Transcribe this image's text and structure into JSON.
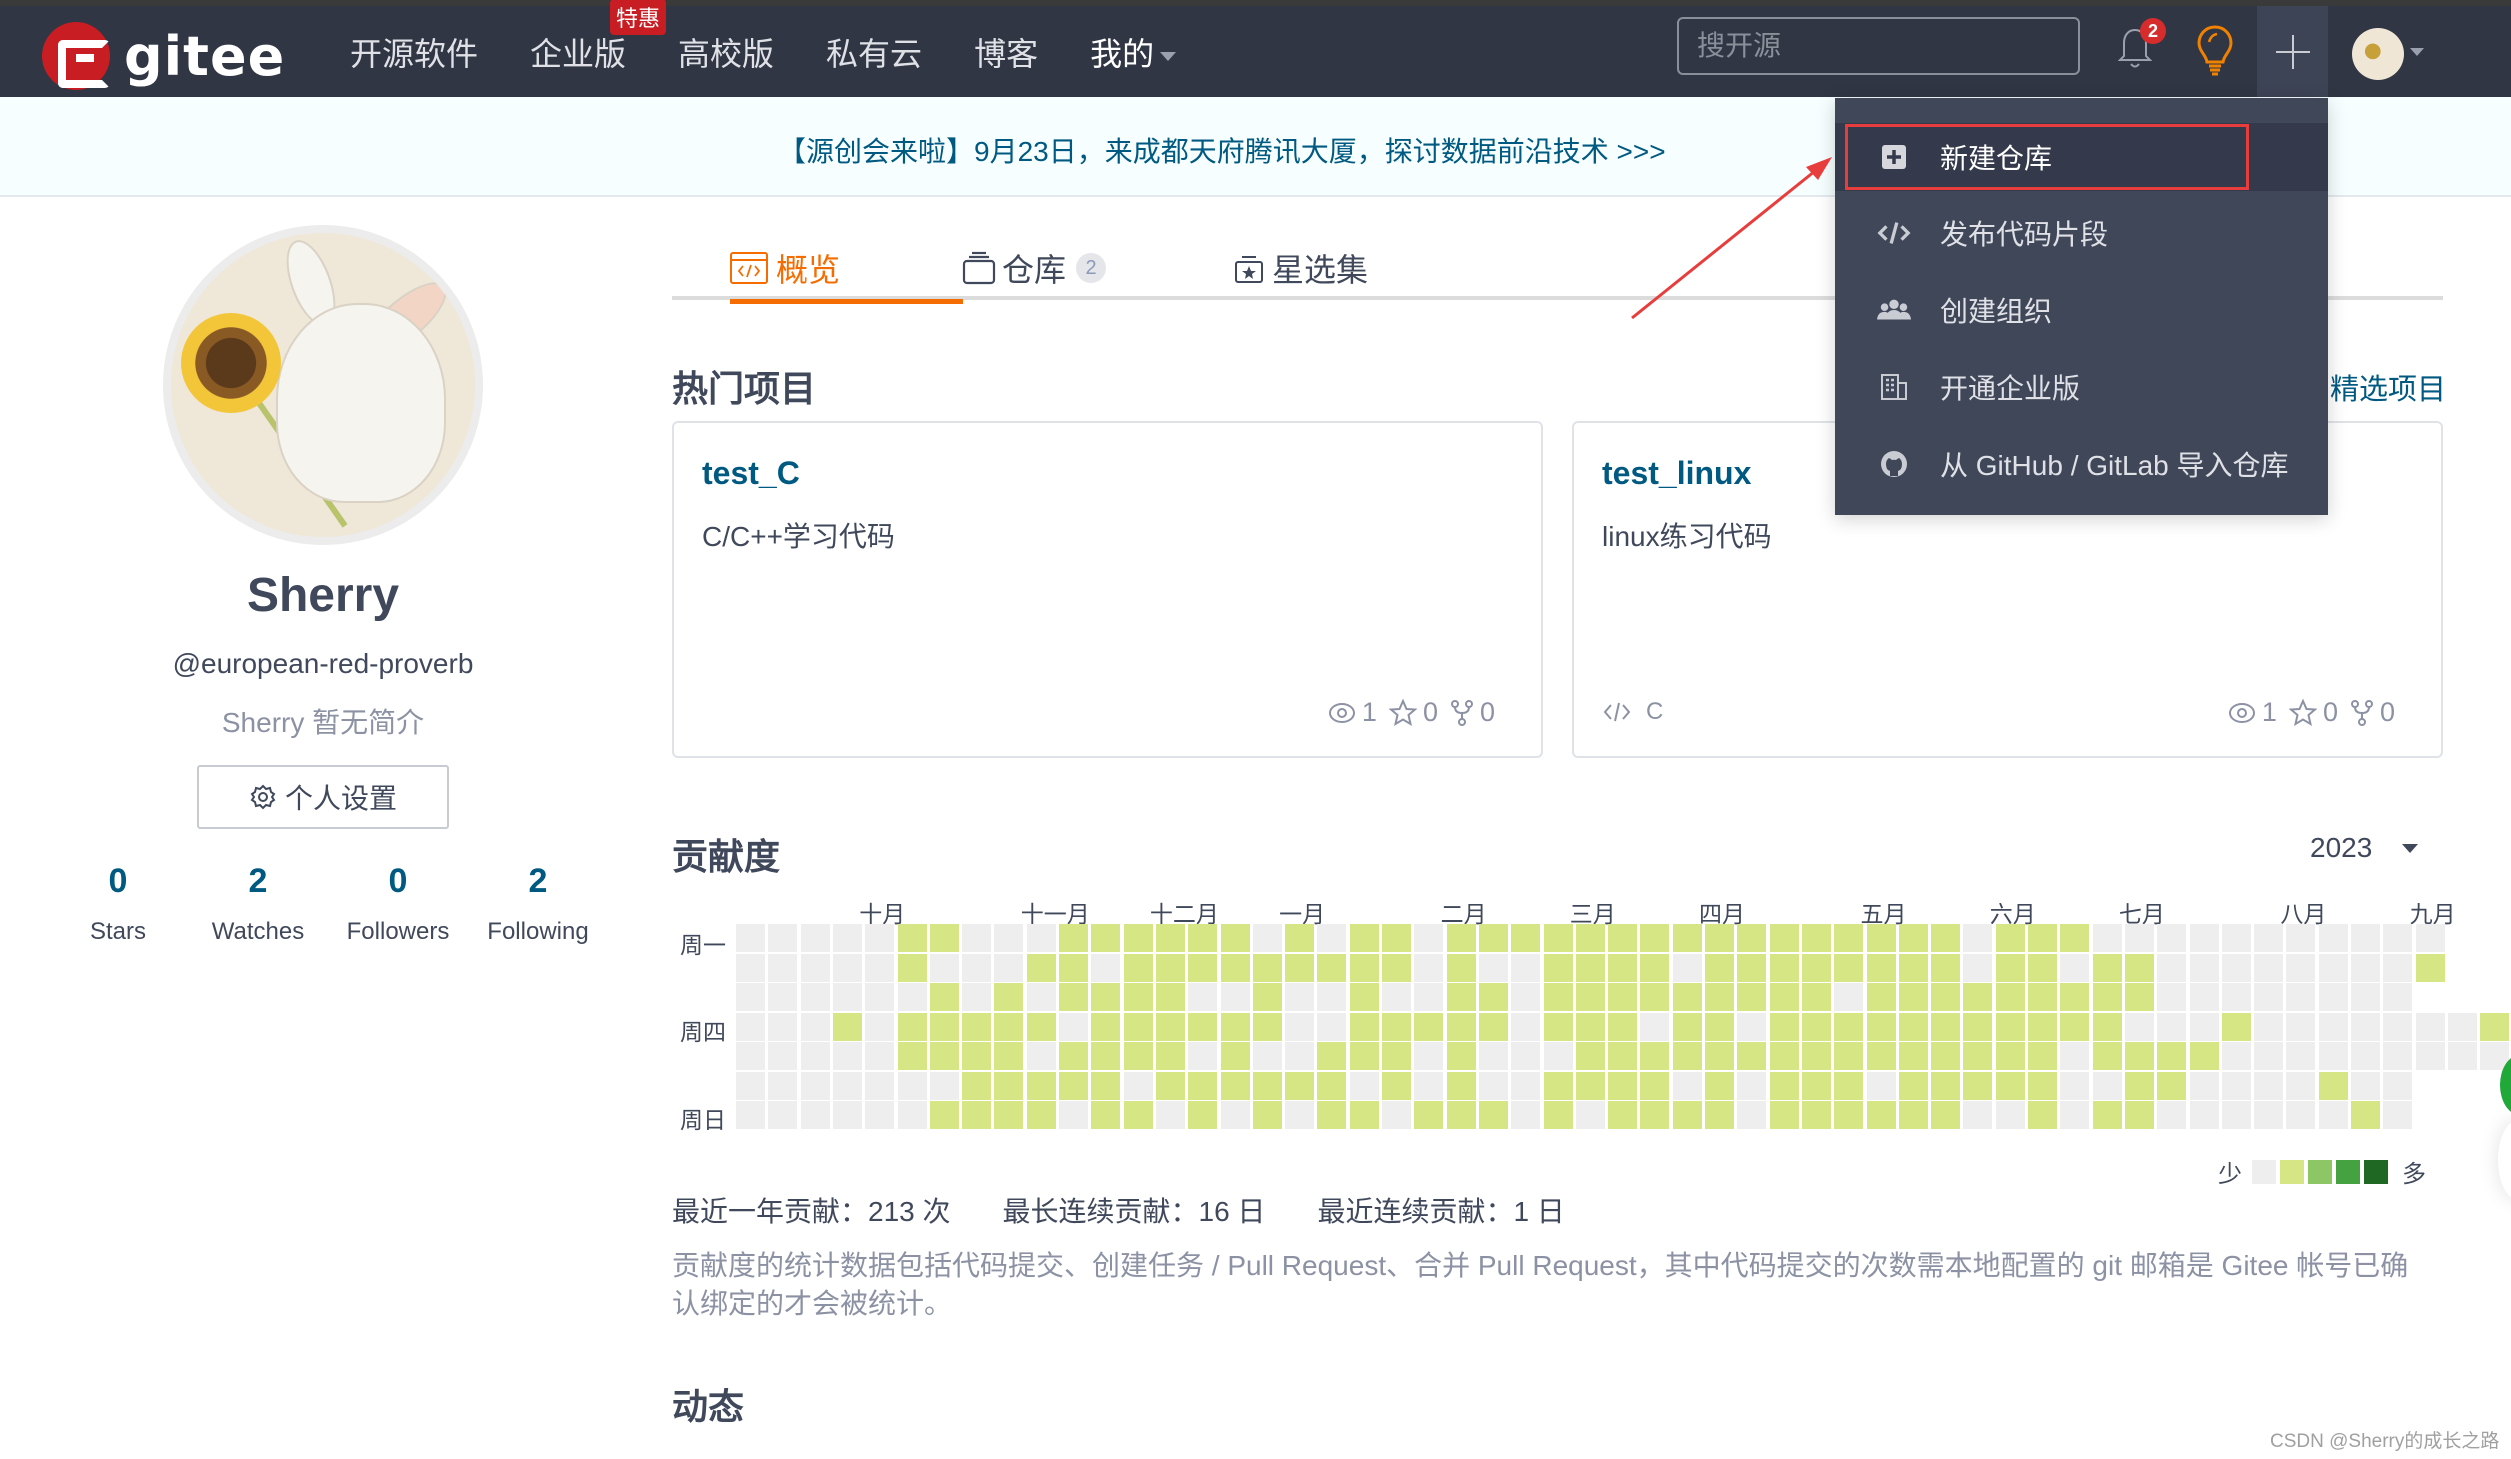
{
  "nav": {
    "brand": "gitee",
    "items": [
      {
        "label": "开源软件"
      },
      {
        "label": "企业版",
        "badge": "特惠"
      },
      {
        "label": "高校版"
      },
      {
        "label": "私有云"
      },
      {
        "label": "博客"
      },
      {
        "label": "我的"
      }
    ],
    "search_placeholder": "搜开源",
    "notification_count": "2"
  },
  "banner": {
    "text": "【源创会来啦】9月23日，来成都天府腾讯大厦，探讨数据前沿技术 >>>"
  },
  "profile": {
    "name": "Sherry",
    "handle": "@european-red-proverb",
    "bio": "Sherry 暂无简介",
    "settings_label": "个人设置",
    "stats": [
      {
        "value": "0",
        "label": "Stars"
      },
      {
        "value": "2",
        "label": "Watches"
      },
      {
        "value": "0",
        "label": "Followers"
      },
      {
        "value": "2",
        "label": "Following"
      }
    ]
  },
  "tabs": [
    {
      "label": "概览",
      "active": true
    },
    {
      "label": "仓库",
      "count": "2"
    },
    {
      "label": "星选集"
    }
  ],
  "hot_projects": {
    "title": "热门项目",
    "featured_link": "精选项目",
    "cards": [
      {
        "name": "test_C",
        "desc": "C/C++学习代码",
        "lang": "",
        "watches": "1",
        "stars": "0",
        "forks": "0"
      },
      {
        "name": "test_linux",
        "desc": "linux练习代码",
        "lang": "C",
        "watches": "1",
        "stars": "0",
        "forks": "0"
      }
    ]
  },
  "contribution": {
    "title": "贡献度",
    "year": "2023",
    "months": [
      "十月",
      "十一月",
      "十二月",
      "一月",
      "二月",
      "三月",
      "四月",
      "五月",
      "六月",
      "七月",
      "八月",
      "九月"
    ],
    "days": [
      "周一",
      "周四",
      "周日"
    ],
    "legend_less": "少",
    "legend_more": "多",
    "legend_colors": [
      "#eeeeee",
      "#d6e685",
      "#8cc665",
      "#44a340",
      "#1e6823"
    ],
    "stats": [
      "最近一年贡献：213 次",
      "最长连续贡献：16 日",
      "最近连续贡献：1 日"
    ],
    "note": "贡献度的统计数据包括代码提交、创建任务 / Pull Request、合并 Pull Request，其中代码提交的次数需本地配置的 git 邮箱是 Gitee 帐号已确认绑定的才会被统计。",
    "grid_rows": [
      "00000110001111110101101111111111111111011100000000000",
      "00000100011011111111101001111011111111011011000000001",
      "0000001010111100100100110111111111011111111100000000",
      "0001011111011111100111110111011011111111111000100000001",
      "0000011110111101001110100011111111111111101111000000000",
      "0000000111110111111010100111101011101111100110000100",
      "0000001111011010101101110101111011111100101100000010"
    ]
  },
  "activity": {
    "title": "动态"
  },
  "dropdown": {
    "items": [
      {
        "label": "新建仓库",
        "icon": "plus-square-icon",
        "highlighted": true
      },
      {
        "label": "发布代码片段",
        "icon": "code-icon"
      },
      {
        "label": "创建组织",
        "icon": "group-icon"
      },
      {
        "label": "开通企业版",
        "icon": "building-icon"
      },
      {
        "label": "从 GitHub / GitLab 导入仓库",
        "icon": "github-icon"
      }
    ]
  },
  "watermark": "CSDN @Sherry的成长之路"
}
